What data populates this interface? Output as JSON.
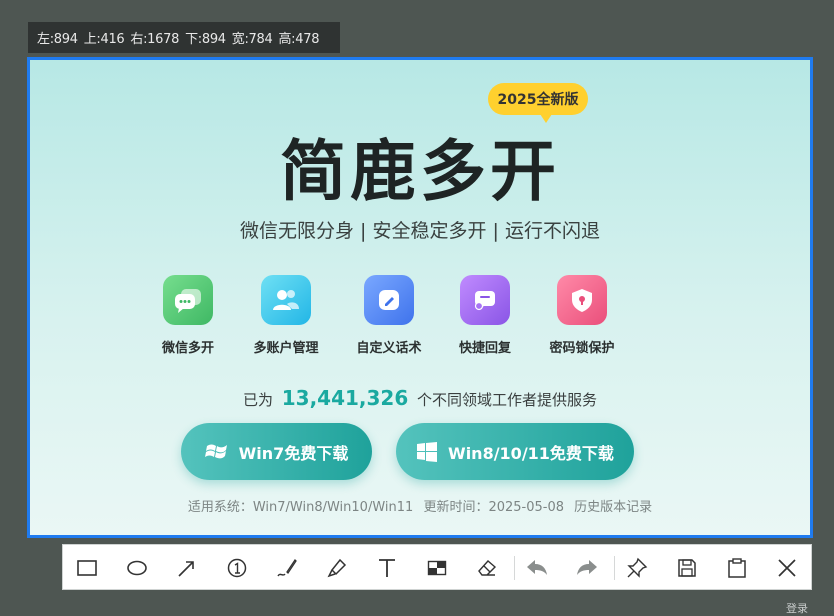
{
  "coords": {
    "left": "左:894",
    "top": "上:416",
    "right": "右:1678",
    "bottom": "下:894",
    "width": "宽:784",
    "height": "高:478"
  },
  "ad": {
    "badge": "2025全新版",
    "title": "简鹿多开",
    "subtitle": "微信无限分身 | 安全稳定多开 | 运行不闪退",
    "features": [
      {
        "label": "微信多开",
        "icon": "chat-bubbles-icon",
        "color": "#52c878"
      },
      {
        "label": "多账户管理",
        "icon": "users-icon",
        "color": "#3fc6ea"
      },
      {
        "label": "自定义话术",
        "icon": "edit-pen-icon",
        "color": "#4f86f4"
      },
      {
        "label": "快捷回复",
        "icon": "message-check-icon",
        "color": "#a86ef0"
      },
      {
        "label": "密码锁保护",
        "icon": "shield-lock-icon",
        "color": "#f0648e"
      }
    ],
    "stats_prefix": "已为",
    "stats_number": "13,441,326",
    "stats_suffix": "个不同领域工作者提供服务",
    "btn_win7": "Win7免费下载",
    "btn_win8": "Win8/10/11免费下载",
    "sys_label": "适用系统：",
    "sys_value": "Win7/Win8/Win10/Win11",
    "update_label": "更新时间：",
    "update_value": "2025-05-08",
    "history_link": "历史版本记录"
  },
  "toolbar": {
    "tools": [
      "rectangle-icon",
      "ellipse-icon",
      "arrow-icon",
      "number-marker-icon",
      "pen-icon",
      "highlighter-icon",
      "text-icon",
      "mosaic-icon",
      "eraser-icon",
      "undo-icon",
      "redo-icon",
      "pin-icon",
      "save-icon",
      "copy-icon",
      "close-icon"
    ]
  },
  "corner_text": "登录"
}
